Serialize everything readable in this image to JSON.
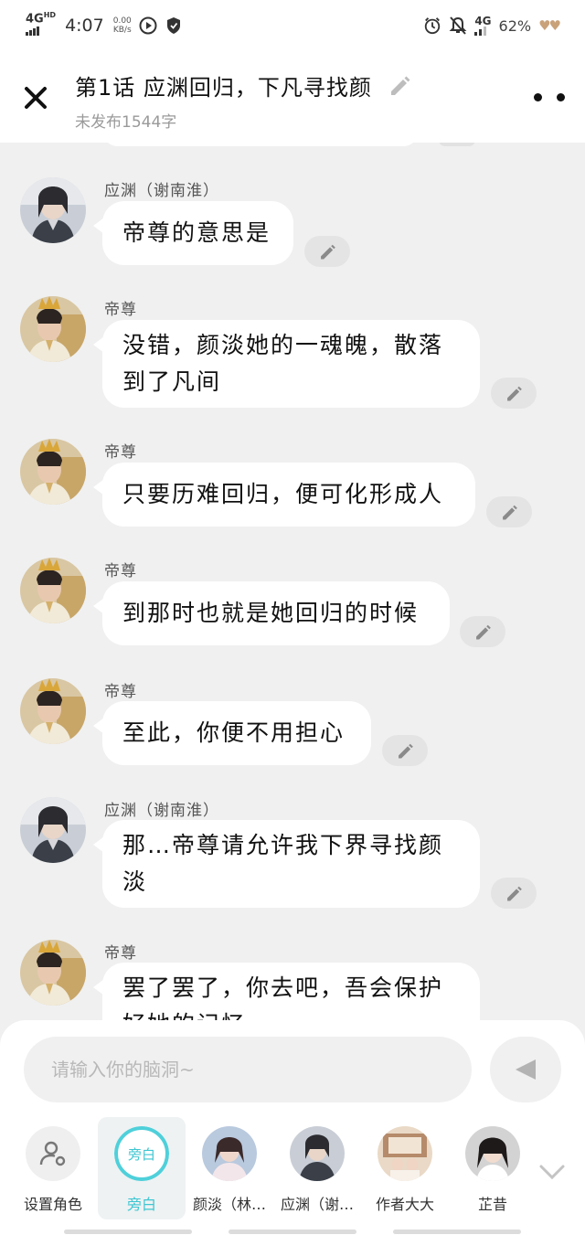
{
  "status_bar": {
    "network": "4G",
    "network_sup": "HD",
    "time": "4:07",
    "speed_value": "0.00",
    "speed_unit": "KB/s",
    "mobile_net": "4G",
    "battery": "62%"
  },
  "header": {
    "title": "第1话  应渊回归，下凡寻找颜",
    "subtitle": "未发布1544字"
  },
  "messages": [
    {
      "speaker": "应渊（谢南淮）",
      "text": "帝尊的意思是"
    },
    {
      "speaker": "帝尊",
      "text": "没错，颜淡她的一魂魄，散落到了凡间"
    },
    {
      "speaker": "帝尊",
      "text": "只要历难回归，便可化形成人"
    },
    {
      "speaker": "帝尊",
      "text": "到那时也就是她回归的时候"
    },
    {
      "speaker": "帝尊",
      "text": "至此，你便不用担心"
    },
    {
      "speaker": "应渊（谢南淮）",
      "text": "那…帝尊请允许我下界寻找颜淡"
    },
    {
      "speaker": "帝尊",
      "text": "罢了罢了，你去吧，吾会保护好她的记忆"
    }
  ],
  "composer": {
    "placeholder": "请输入你的脑洞~"
  },
  "roles": [
    {
      "label": "设置角色"
    },
    {
      "label": "旁白",
      "badge": "旁白"
    },
    {
      "label": "颜淡（林…"
    },
    {
      "label": "应渊（谢…"
    },
    {
      "label": "作者大大"
    },
    {
      "label": "芷昔"
    }
  ],
  "colors": {
    "accent": "#4fd0da",
    "background": "#f0f0f0",
    "bubble": "#ffffff"
  }
}
